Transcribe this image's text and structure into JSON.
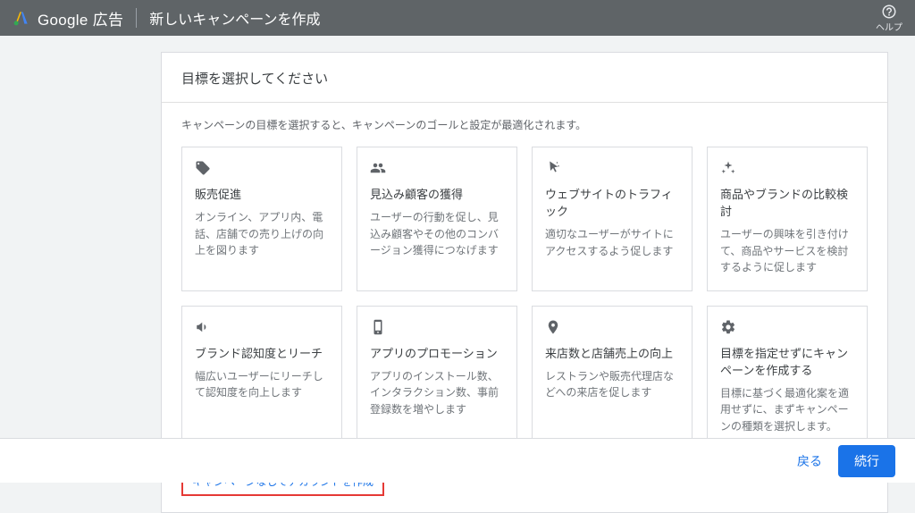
{
  "header": {
    "product": "Google 広告",
    "page_title": "新しいキャンペーンを作成",
    "help_label": "ヘルプ"
  },
  "main": {
    "section_title": "目標を選択してください",
    "section_desc": "キャンペーンの目標を選択すると、キャンペーンのゴールと設定が最適化されます。",
    "goals": [
      {
        "icon": "tag-icon",
        "title": "販売促進",
        "desc": "オンライン、アプリ内、電話、店舗での売り上げの向上を図ります"
      },
      {
        "icon": "people-icon",
        "title": "見込み顧客の獲得",
        "desc": "ユーザーの行動を促し、見込み顧客やその他のコンバージョン獲得につなげます"
      },
      {
        "icon": "cursor-icon",
        "title": "ウェブサイトのトラフィック",
        "desc": "適切なユーザーがサイトにアクセスするよう促します"
      },
      {
        "icon": "sparkle-icon",
        "title": "商品やブランドの比較検討",
        "desc": "ユーザーの興味を引き付けて、商品やサービスを検討するように促します"
      },
      {
        "icon": "megaphone-icon",
        "title": "ブランド認知度とリーチ",
        "desc": "幅広いユーザーにリーチして認知度を向上します"
      },
      {
        "icon": "phone-icon",
        "title": "アプリのプロモーション",
        "desc": "アプリのインストール数、インタラクション数、事前登録数を増やします"
      },
      {
        "icon": "pin-icon",
        "title": "来店数と店舗売上の向上",
        "desc": "レストランや販売代理店などへの来店を促します"
      },
      {
        "icon": "gear-icon",
        "title": "目標を指定せずにキャンペーンを作成する",
        "desc": "目標に基づく最適化案を適用せずに、まずキャンペーンの種類を選択します。"
      }
    ],
    "no_campaign_link": "キャンペーンなしでアカウントを作成"
  },
  "footer": {
    "back": "戻る",
    "continue": "続行"
  }
}
